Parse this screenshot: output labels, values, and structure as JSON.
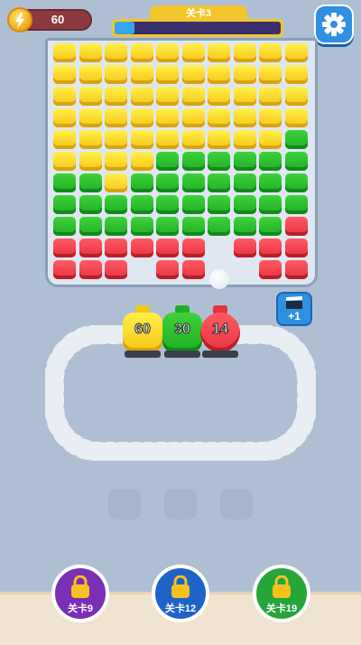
{
  "hud": {
    "coins": "60",
    "level_label": "关卡3",
    "level_progress": 0.12
  },
  "bonus": {
    "label": "+1"
  },
  "trains": [
    {
      "number": "60",
      "color": "yellow"
    },
    {
      "number": "30",
      "color": "green"
    },
    {
      "number": "14",
      "color": "red"
    }
  ],
  "locked_levels": [
    {
      "label": "关卡9",
      "color": "#7b2fb5"
    },
    {
      "label": "关卡12",
      "color": "#1f63c9"
    },
    {
      "label": "关卡19",
      "color": "#26a53a"
    }
  ],
  "colors": {
    "yellow": "#f6c515",
    "green": "#1fae24",
    "red": "#e8323f"
  }
}
